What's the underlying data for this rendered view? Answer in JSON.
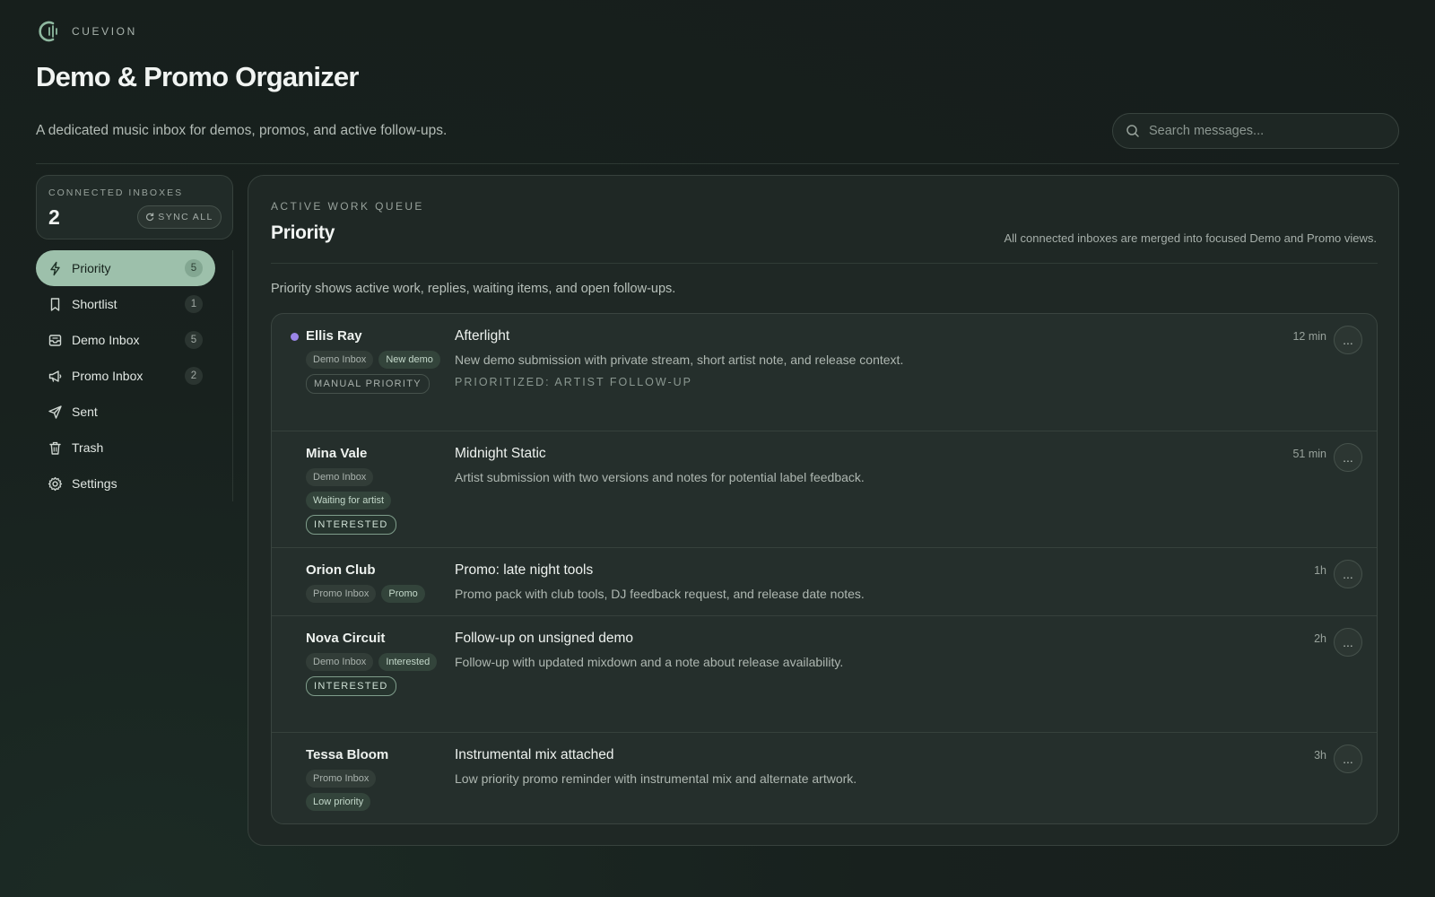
{
  "brand": {
    "name": "CUEVION"
  },
  "header": {
    "title": "Demo & Promo Organizer",
    "subtitle": "A dedicated music inbox for demos, promos, and active follow-ups.",
    "search_placeholder": "Search messages..."
  },
  "inboxes": {
    "label": "CONNECTED INBOXES",
    "count": "2",
    "sync_label": "SYNC ALL"
  },
  "nav": {
    "items": [
      {
        "label": "Priority",
        "count": "5",
        "icon": "lightning-icon",
        "active": true
      },
      {
        "label": "Shortlist",
        "count": "1",
        "icon": "bookmark-icon"
      },
      {
        "label": "Demo Inbox",
        "count": "5",
        "icon": "inbox-icon"
      },
      {
        "label": "Promo Inbox",
        "count": "2",
        "icon": "megaphone-icon"
      },
      {
        "label": "Sent",
        "count": "",
        "icon": "send-icon"
      },
      {
        "label": "Trash",
        "count": "",
        "icon": "trash-icon"
      },
      {
        "label": "Settings",
        "count": "",
        "icon": "gear-icon"
      }
    ]
  },
  "queue": {
    "label": "ACTIVE WORK QUEUE",
    "title": "Priority",
    "merged_note": "All connected inboxes are merged into focused Demo and Promo views.",
    "description": "Priority shows active work, replies, waiting items, and open follow-ups."
  },
  "messages": [
    {
      "sender": "Ellis Ray",
      "unread": true,
      "source": "Demo Inbox",
      "status": "New demo",
      "flag": "MANUAL PRIORITY",
      "subject": "Afterlight",
      "preview": "New demo submission with private stream, short artist note, and release context.",
      "prioritized": "PRIORITIZED: ARTIST FOLLOW-UP",
      "time": "12 min",
      "more": "..."
    },
    {
      "sender": "Mina Vale",
      "source": "Demo Inbox",
      "status": "Waiting for artist",
      "flag": "INTERESTED",
      "subject": "Midnight Static",
      "preview": "Artist submission with two versions and notes for potential label feedback.",
      "time": "51 min",
      "more": "..."
    },
    {
      "sender": "Orion Club",
      "source": "Promo Inbox",
      "status": "Promo",
      "subject": "Promo: late night tools",
      "preview": "Promo pack with club tools, DJ feedback request, and release date notes.",
      "time": "1h",
      "more": "..."
    },
    {
      "sender": "Nova Circuit",
      "source": "Demo Inbox",
      "status": "Interested",
      "flag": "INTERESTED",
      "subject": "Follow-up on unsigned demo",
      "preview": "Follow-up with updated mixdown and a note about release availability.",
      "time": "2h",
      "more": "..."
    },
    {
      "sender": "Tessa Bloom",
      "source": "Promo Inbox",
      "status": "Low priority",
      "subject": "Instrumental mix attached",
      "preview": "Low priority promo reminder with instrumental mix and alternate artwork.",
      "time": "3h",
      "more": "..."
    }
  ],
  "colors": {
    "accent": "#9dc0ab",
    "unread_dot": "#9b86e8",
    "background": "#18211e"
  }
}
